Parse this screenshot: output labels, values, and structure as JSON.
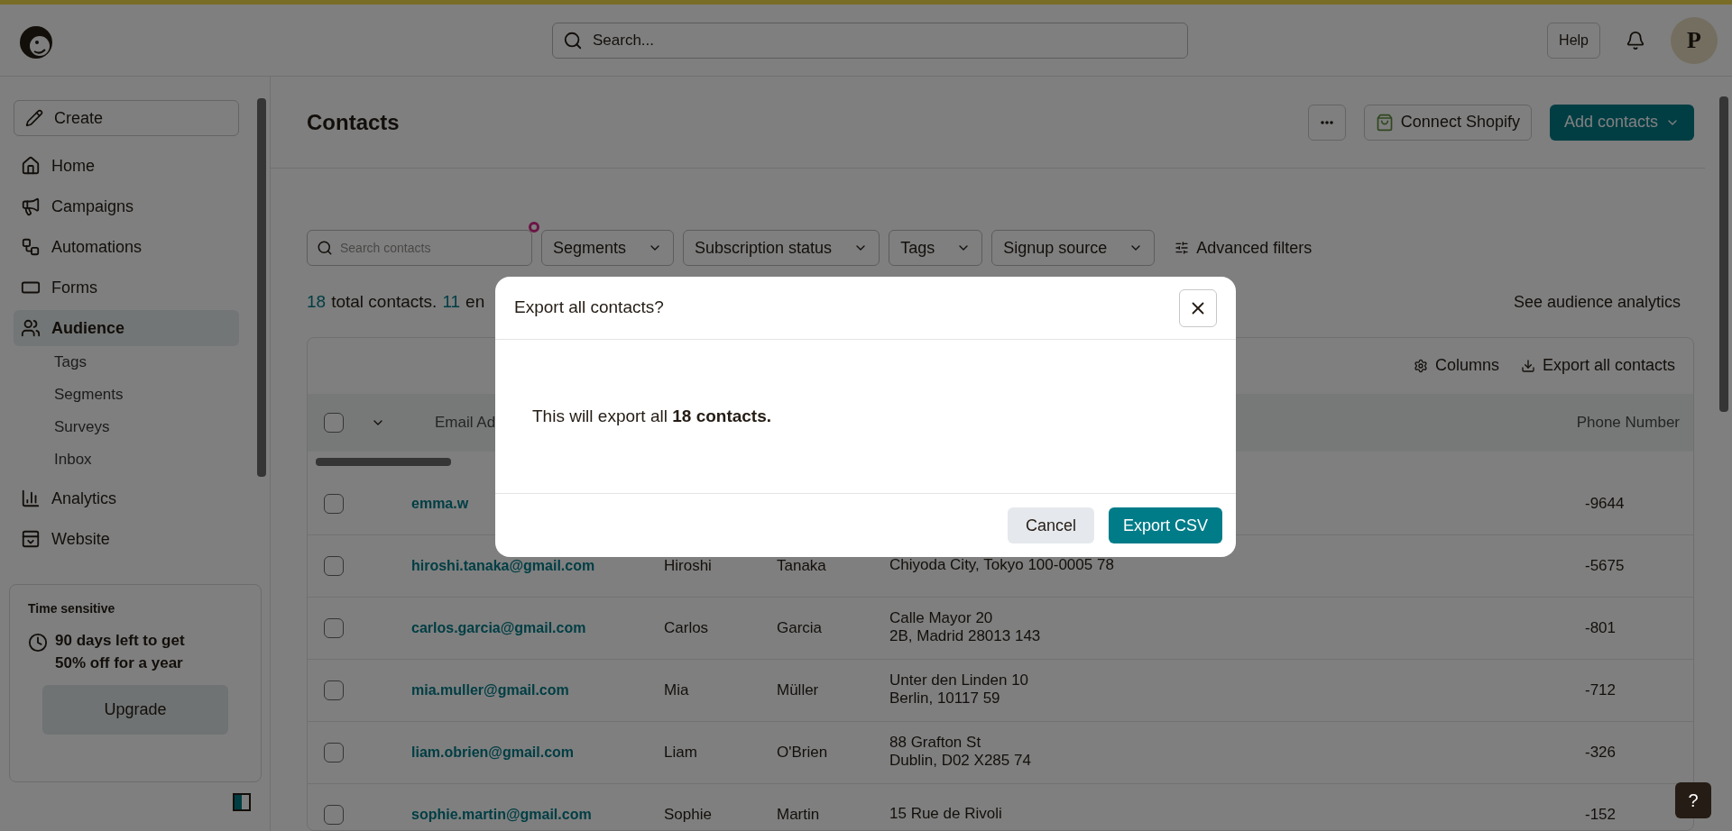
{
  "header": {
    "search": {
      "placeholder": "Search..."
    },
    "help": "Help",
    "avatar": "P"
  },
  "sidebar": {
    "create": "Create",
    "items": [
      {
        "label": "Home",
        "selected": false
      },
      {
        "label": "Campaigns",
        "selected": false
      },
      {
        "label": "Automations",
        "selected": false
      },
      {
        "label": "Forms",
        "selected": false
      },
      {
        "label": "Audience",
        "selected": true,
        "children": [
          {
            "label": "Tags"
          },
          {
            "label": "Segments"
          },
          {
            "label": "Surveys"
          },
          {
            "label": "Inbox"
          }
        ]
      },
      {
        "label": "Analytics",
        "selected": false
      },
      {
        "label": "Website",
        "selected": false
      }
    ],
    "promo": {
      "title": "Time sensitive",
      "text": "90 days left to get 50% off for a year",
      "button": "Upgrade"
    }
  },
  "page": {
    "title": "Contacts",
    "connect": "Connect Shopify",
    "add": "Add contacts"
  },
  "filters": {
    "search": {
      "placeholder": "Search contacts"
    },
    "dropdowns": [
      "Segments",
      "Subscription status",
      "Tags",
      "Signup source"
    ],
    "advanced": "Advanced filters"
  },
  "summary": {
    "total": "18",
    "total_label": "total contacts.",
    "count_2": "11",
    "label_2": "en",
    "analytics_link": "See audience analytics"
  },
  "table": {
    "toolbar": {
      "columns": "Columns",
      "export": "Export all contacts"
    },
    "header_checked": false,
    "columns": [
      {
        "label": "Email Ad"
      },
      {
        "label": "Phone Number"
      }
    ],
    "rows": [
      {
        "checked": false,
        "email": "emma.w",
        "phone": "-9644"
      },
      {
        "checked": false,
        "email": "hiroshi.tanaka@gmail.com",
        "first_name": "Hiroshi",
        "last_name": "Tanaka",
        "address": [
          "Chiyoda City, Tokyo 100-0005 78"
        ],
        "phone": "-5675"
      },
      {
        "checked": false,
        "email": "carlos.garcia@gmail.com",
        "first_name": "Carlos",
        "last_name": "Garcia",
        "address": [
          "Calle Mayor 20",
          "2B, Madrid 28013 143"
        ],
        "phone": "-801"
      },
      {
        "checked": false,
        "email": "mia.muller@gmail.com",
        "first_name": "Mia",
        "last_name": "Müller",
        "address": [
          "Unter den Linden 10",
          "Berlin, 10117 59"
        ],
        "phone": "-712"
      },
      {
        "checked": false,
        "email": "liam.obrien@gmail.com",
        "first_name": "Liam",
        "last_name": "O'Brien",
        "address": [
          "88 Grafton St",
          "Dublin, D02 X285 74"
        ],
        "phone": "-326"
      },
      {
        "checked": false,
        "email": "sophie.martin@gmail.com",
        "first_name": "Sophie",
        "last_name": "Martin",
        "address": [
          "15 Rue de Rivoli"
        ],
        "phone": "-152"
      }
    ]
  },
  "help_button": "?",
  "modal": {
    "title": "Export all contacts?",
    "body": "This will export all **18 contacts.**",
    "cancel": "Cancel",
    "confirm": "Export CSV"
  }
}
